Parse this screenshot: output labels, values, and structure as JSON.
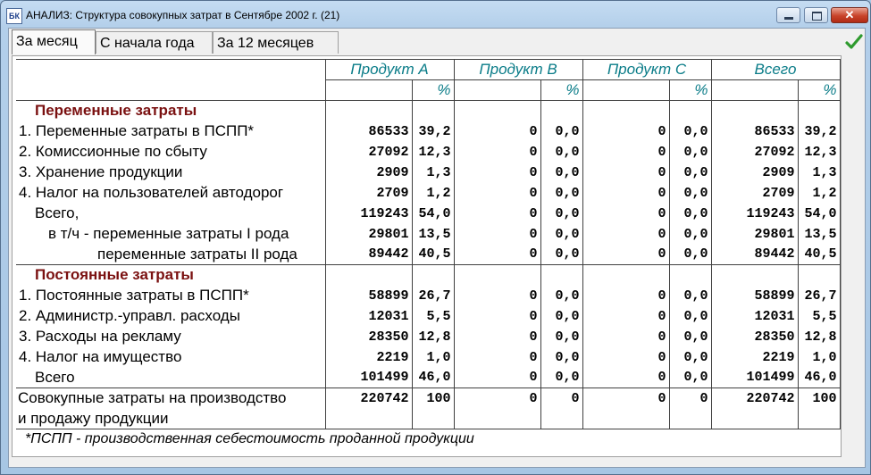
{
  "window": {
    "icon_text": "БК",
    "title": "АНАЛИЗ: Структура совокупных затрат в Сентябре 2002 г. (21)",
    "minimize_label": "",
    "maximize_label": "",
    "close_label": "✕"
  },
  "tabs": [
    {
      "label": "За месяц",
      "active": true
    },
    {
      "label": "С начала года",
      "active": false
    },
    {
      "label": "За 12 месяцев",
      "active": false
    }
  ],
  "table": {
    "columns": [
      "Продукт A",
      "Продукт B",
      "Продукт C",
      "Всего"
    ],
    "pct_label": "%",
    "section1_title": "Переменные затраты",
    "section1_rows": [
      {
        "label": "1. Переменные затраты в ПСПП*",
        "a": "86533",
        "ap": "39,2",
        "b": "0",
        "bp": "0,0",
        "c": "0",
        "cp": "0,0",
        "t": "86533",
        "tp": "39,2"
      },
      {
        "label": "2. Комиссионные по сбыту",
        "a": "27092",
        "ap": "12,3",
        "b": "0",
        "bp": "0,0",
        "c": "0",
        "cp": "0,0",
        "t": "27092",
        "tp": "12,3"
      },
      {
        "label": "3. Хранение продукции",
        "a": "2909",
        "ap": "1,3",
        "b": "0",
        "bp": "0,0",
        "c": "0",
        "cp": "0,0",
        "t": "2909",
        "tp": "1,3"
      },
      {
        "label": "4. Налог на пользователей автодорог",
        "a": "2709",
        "ap": "1,2",
        "b": "0",
        "bp": "0,0",
        "c": "0",
        "cp": "0,0",
        "t": "2709",
        "tp": "1,2"
      },
      {
        "label": "Всего,",
        "a": "119243",
        "ap": "54,0",
        "b": "0",
        "bp": "0,0",
        "c": "0",
        "cp": "0,0",
        "t": "119243",
        "tp": "54,0"
      },
      {
        "label": "в т/ч - переменные затраты I рода",
        "a": "29801",
        "ap": "13,5",
        "b": "0",
        "bp": "0,0",
        "c": "0",
        "cp": "0,0",
        "t": "29801",
        "tp": "13,5"
      },
      {
        "label": "переменные затраты II рода",
        "a": "89442",
        "ap": "40,5",
        "b": "0",
        "bp": "0,0",
        "c": "0",
        "cp": "0,0",
        "t": "89442",
        "tp": "40,5"
      }
    ],
    "section2_title": "Постоянные затраты",
    "section2_rows": [
      {
        "label": "1. Постоянные затраты в ПСПП*",
        "a": "58899",
        "ap": "26,7",
        "b": "0",
        "bp": "0,0",
        "c": "0",
        "cp": "0,0",
        "t": "58899",
        "tp": "26,7"
      },
      {
        "label": "2. Администр.-управл. расходы",
        "a": "12031",
        "ap": "5,5",
        "b": "0",
        "bp": "0,0",
        "c": "0",
        "cp": "0,0",
        "t": "12031",
        "tp": "5,5"
      },
      {
        "label": "3. Расходы на рекламу",
        "a": "28350",
        "ap": "12,8",
        "b": "0",
        "bp": "0,0",
        "c": "0",
        "cp": "0,0",
        "t": "28350",
        "tp": "12,8"
      },
      {
        "label": "4. Налог на имущество",
        "a": "2219",
        "ap": "1,0",
        "b": "0",
        "bp": "0,0",
        "c": "0",
        "cp": "0,0",
        "t": "2219",
        "tp": "1,0"
      },
      {
        "label": "Всего",
        "a": "101499",
        "ap": "46,0",
        "b": "0",
        "bp": "0,0",
        "c": "0",
        "cp": "0,0",
        "t": "101499",
        "tp": "46,0"
      }
    ],
    "total": {
      "label_line1": "Совокупные затраты на производство",
      "label_line2": "и продажу продукции",
      "a": "220742",
      "ap": "100",
      "b": "0",
      "bp": "0",
      "c": "0",
      "cp": "0",
      "t": "220742",
      "tp": "100"
    }
  },
  "footnote": "*ПСПП - производственная себестоимость проданной продукции",
  "icons": {
    "ok": "check-icon",
    "app": "app-icon"
  },
  "colors": {
    "header_teal": "#0a7c88",
    "section_title": "#7a1010",
    "ok_green": "#2e9a2e"
  }
}
